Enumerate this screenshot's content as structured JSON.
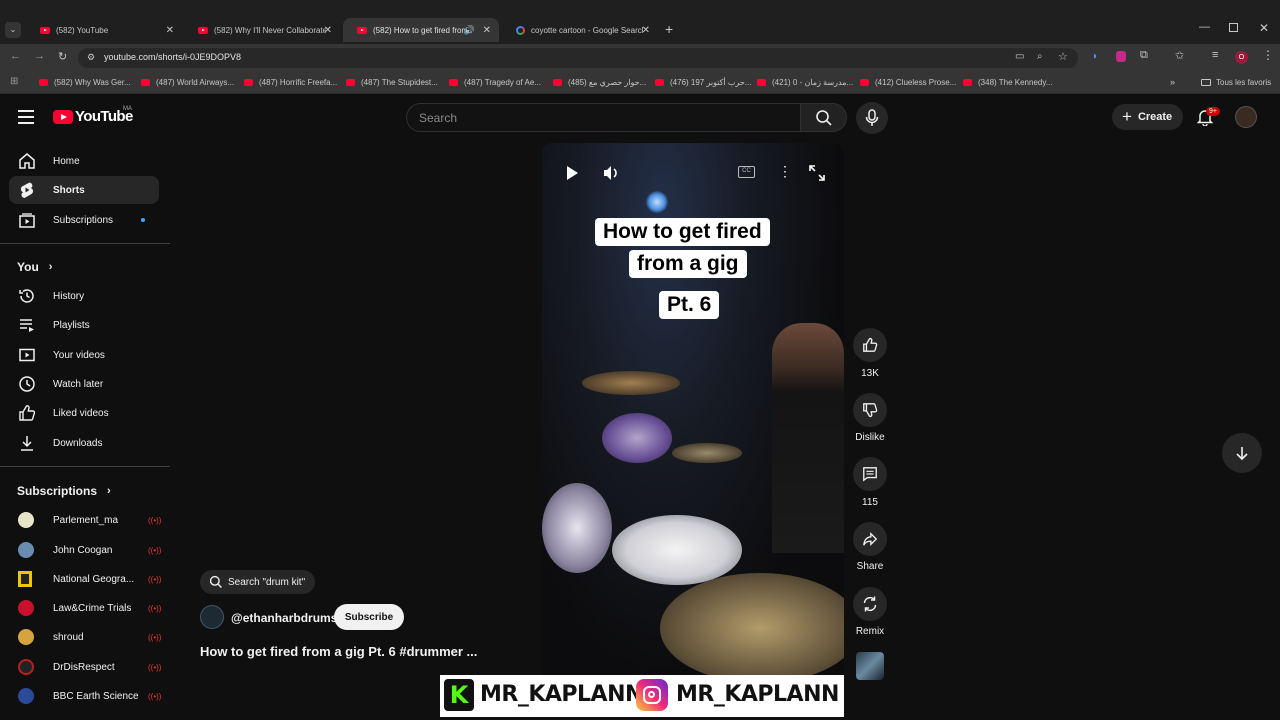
{
  "browser": {
    "tabs": [
      {
        "label": "(582) YouTube",
        "type": "youtube"
      },
      {
        "label": "(582) Why I'll Never Collaborate",
        "type": "youtube"
      },
      {
        "label": "(582) How to get fired from",
        "type": "youtube"
      },
      {
        "label": "coyotte cartoon - Google Search",
        "type": "google"
      }
    ],
    "url": "youtube.com/shorts/i-0JE9DOPV8",
    "bookmarks": [
      "(582) Why Was Ger...",
      "(487) World Airways...",
      "(487) Horrific Freefa...",
      "(487) The Stupidest...",
      "(487) Tragedy of Ae...",
      "(485) حوار حصري مع...",
      "(476) حرب أكتوبر 197...",
      "(421) مدرسة زمان - 0...",
      "(412) Clueless Prose...",
      "(348) The Kennedy..."
    ],
    "all_bookmarks": "Tous les favoris",
    "profile_initial": "O"
  },
  "header": {
    "logo": "YouTube",
    "country": "MA",
    "search_placeholder": "Search",
    "create_label": "Create",
    "notif_count": "9+"
  },
  "sidebar": {
    "main": [
      {
        "label": "Home",
        "icon": "home-icon"
      },
      {
        "label": "Shorts",
        "icon": "shorts-icon"
      },
      {
        "label": "Subscriptions",
        "icon": "subscriptions-icon"
      }
    ],
    "you_heading": "You",
    "you_items": [
      {
        "label": "History",
        "icon": "history-icon"
      },
      {
        "label": "Playlists",
        "icon": "playlists-icon"
      },
      {
        "label": "Your videos",
        "icon": "your-videos-icon"
      },
      {
        "label": "Watch later",
        "icon": "watch-later-icon"
      },
      {
        "label": "Liked videos",
        "icon": "liked-icon"
      },
      {
        "label": "Downloads",
        "icon": "downloads-icon"
      }
    ],
    "subs_heading": "Subscriptions",
    "subscriptions": [
      {
        "label": "Parlement_ma",
        "color": "#e8e4c8"
      },
      {
        "label": "John Coogan",
        "color": "#6a8caf"
      },
      {
        "label": "National Geogra...",
        "color": "#f5c400"
      },
      {
        "label": "Law&Crime Trials",
        "color": "#c8102e"
      },
      {
        "label": "shroud",
        "color": "#d4a440"
      },
      {
        "label": "DrDisRespect",
        "color": "#b22222"
      },
      {
        "label": "BBC Earth Science",
        "color": "#2b4a9a"
      }
    ]
  },
  "short": {
    "caption_lines": [
      "How to get fired",
      "from a gig",
      "Pt. 6"
    ],
    "likes": "13K",
    "dislike_label": "Dislike",
    "comments": "115",
    "share_label": "Share",
    "remix_label": "Remix",
    "search_chip": "Search \"drum kit\"",
    "channel": "@ethanharbdrums",
    "subscribe_label": "Subscribe",
    "title": "How to get fired from a gig Pt. 6 #drummer ..."
  },
  "overlay": {
    "handle_1": "MR_KAPLANN",
    "handle_2": "MR_KAPLANN",
    "colors": {
      "kick": "#53fc18",
      "instagram": "#e1306c"
    }
  }
}
